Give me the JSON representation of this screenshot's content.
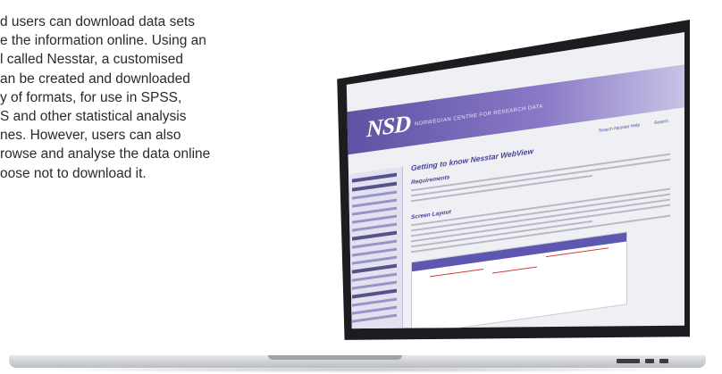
{
  "intro": {
    "lines": [
      "d users can download data sets",
      "e the information online. Using an",
      "l called Nesstar, a customised",
      "an be created and downloaded",
      "y of formats, for use in SPSS,",
      "S and other statistical analysis",
      "nes. However, users can also",
      "rowse and analyse the data online",
      "oose not to download it."
    ]
  },
  "screen": {
    "logo": "NSD",
    "header_subtitle": "NORWEGIAN CENTRE FOR RESEARCH DATA",
    "top_links": [
      "Search Nesstar Help",
      "Search"
    ],
    "page_title": "Getting to know Nesstar WebView",
    "section_requirements": "Requirements",
    "section_layout": "Screen Layout"
  },
  "colors": {
    "header_gradient_start": "#5b4da0",
    "header_gradient_end": "#c9c2e6",
    "heading_purple": "#4a3f9c",
    "laptop_bezel": "#1b1d20",
    "laptop_aluminium": "#c4c7cb"
  }
}
